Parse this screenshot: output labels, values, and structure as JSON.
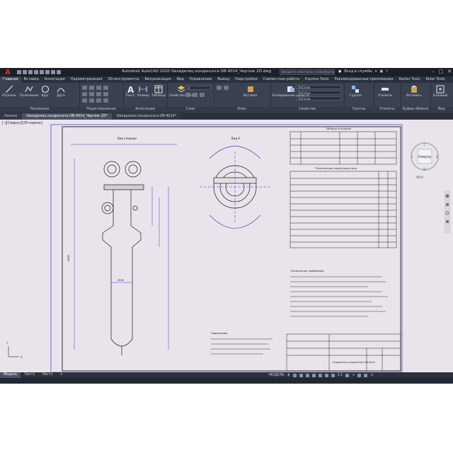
{
  "app": {
    "logo_letter": "A",
    "title": "Autodesk AutoCAD 2020   Овладелец конденсата ОВ-4014_Чертеж 2D.dwg",
    "search_placeholder": "Введите ключевое слово/фразу",
    "sign_in": "Вход в службы",
    "sign_in_arrow": "▾",
    "help": "?",
    "win_min": "–",
    "win_max": "□",
    "win_close": "✕"
  },
  "ribbon_tabs": [
    {
      "label": "Главная",
      "active": true
    },
    {
      "label": "Вставка"
    },
    {
      "label": "Аннотации"
    },
    {
      "label": "Параметризация"
    },
    {
      "label": "3D-инструменты"
    },
    {
      "label": "Визуализация"
    },
    {
      "label": "Вид"
    },
    {
      "label": "Управление"
    },
    {
      "label": "Вывод"
    },
    {
      "label": "Надстройки"
    },
    {
      "label": "Совместная работа"
    },
    {
      "label": "Express Tools"
    },
    {
      "label": "Рекомендованные приложения"
    },
    {
      "label": "Raster Tools"
    },
    {
      "label": "Rider Tools"
    }
  ],
  "ribbon": {
    "draw_tools": [
      "Отрезок",
      "Полилиния",
      "Круг",
      "Дуга"
    ],
    "text_tool": "Текст",
    "dim_tool": "Размер",
    "table_tool": "Таблица",
    "layer_props": "Свойства слоя",
    "insert": "Вставка",
    "block_edit": "Редактировать",
    "copy_props": "Копирование свойств",
    "group": "Группа",
    "utilities": "Утилиты",
    "clipboard": "Вставить",
    "base": "Базовый",
    "layer_combo": "0",
    "bylayer_1": "ПоСлою",
    "bylayer_2": "ПоСлою",
    "bylayer_3": "ПоСлою",
    "panels": [
      "Рисование",
      "Редактирование",
      "Аннотации",
      "Слои",
      "Блок",
      "Свойства",
      "Группы",
      "Утилиты",
      "Буфер обмена",
      "Вид"
    ]
  },
  "doc_tabs": [
    {
      "label": "Начало"
    },
    {
      "label": "Овладелец конденсата ОВ-4014_Чертеж 2D*",
      "active": true
    },
    {
      "label": "Овладелец конденсата ОВ-4014*"
    }
  ],
  "viewport": {
    "label": "[–][Сверху][2D-каркас]",
    "viewcube_face": "Сверху",
    "viewcube_n": "С",
    "viewcube_s": "Ю",
    "viewcube_w": "З",
    "viewcube_e": "В",
    "wcs": "МСК",
    "ucs_y": "Y",
    "ucs_x": "X"
  },
  "drawing": {
    "view_a_label": "Вид спереди",
    "view_b_label": "Вид А",
    "table1_title": "Таблица штуцеров",
    "table2_title": "Техническая характеристика",
    "tech_title": "Технические требования",
    "notes_title": "Примечания",
    "stamp_title": "Отделитель конденсата ОВ-4014",
    "dim_a": "4500",
    "dim_b": "6480"
  },
  "layout_tabs": [
    {
      "label": "Модель",
      "active": true
    },
    {
      "label": "Лист1"
    },
    {
      "label": "Лист2"
    },
    {
      "label": "+"
    }
  ],
  "status": {
    "model": "МОДЕЛЬ",
    "grid": "⋕",
    "scale": "1:1",
    "plus": "+",
    "menu": "≡"
  }
}
